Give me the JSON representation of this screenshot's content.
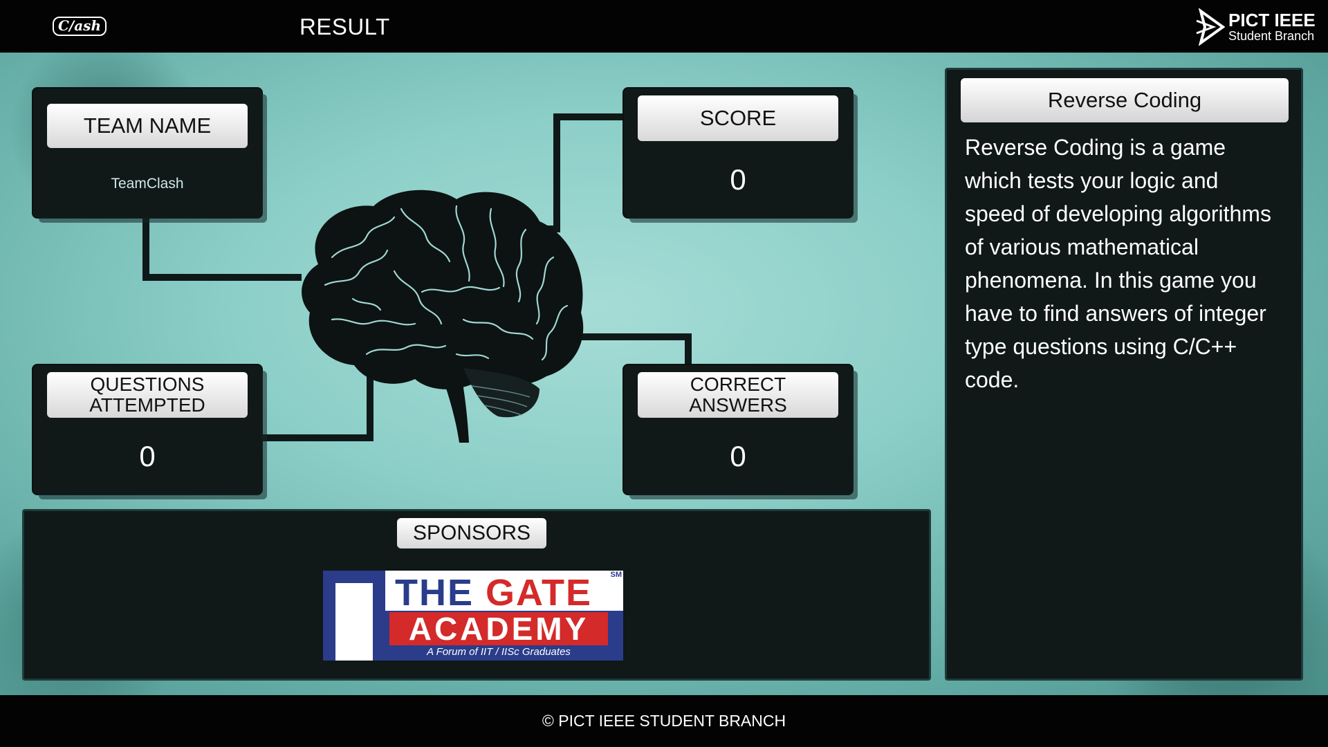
{
  "header": {
    "logo_text": "C/ash",
    "title": "RESULT",
    "branch_logo": {
      "line1": "PICT IEEE",
      "line2": "Student Branch"
    }
  },
  "cards": {
    "team_name": {
      "label": "TEAM NAME",
      "value": "TeamClash"
    },
    "score": {
      "label": "SCORE",
      "value": "0"
    },
    "questions_attempted": {
      "label": "QUESTIONS ATTEMPTED",
      "value": "0"
    },
    "correct_answers": {
      "label": "CORRECT ANSWERS",
      "value": "0"
    }
  },
  "game": {
    "title": "Reverse Coding",
    "description": "Reverse Coding is a game which tests your logic and speed of developing algorithms of various mathematical phenomena. In this game you have to find answers of integer type questions using C/C++ code."
  },
  "sponsors": {
    "label": "SPONSORS",
    "logo": {
      "word1": "THE",
      "word2": "GATE",
      "word3": "ACADEMY",
      "tagline": "A Forum of  IIT / IISc Graduates",
      "mark": "SM"
    }
  },
  "footer": {
    "text": "© PICT IEEE STUDENT BRANCH"
  },
  "colors": {
    "card_bg": "#101818",
    "accent_teal": "#8ccfc8",
    "gate_blue": "#2a3c8a",
    "gate_red": "#d42a2a"
  }
}
